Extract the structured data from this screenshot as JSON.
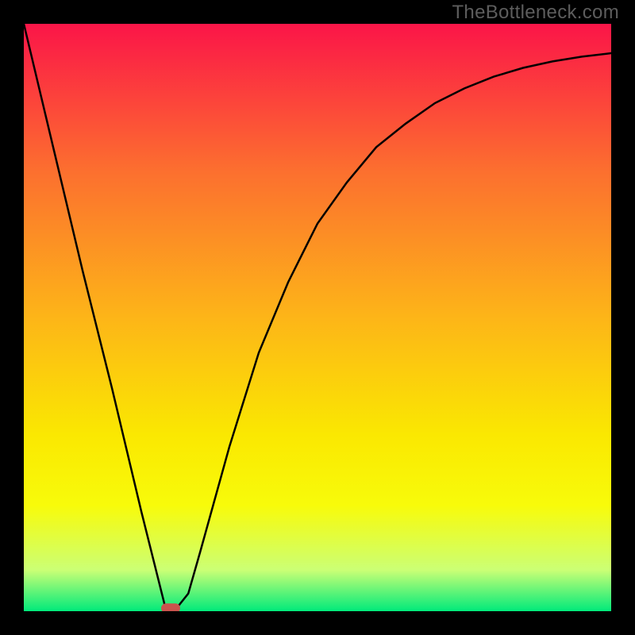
{
  "watermark": "TheBottleneck.com",
  "chart_data": {
    "type": "line",
    "title": "",
    "xlabel": "",
    "ylabel": "",
    "xlim": [
      0,
      100
    ],
    "ylim": [
      0,
      100
    ],
    "annotations": [],
    "background_gradient": {
      "c0": "#fb1548",
      "c25": "#fc6f2f",
      "c50": "#fdb518",
      "c70": "#fae801",
      "c80": "#f8fb0a",
      "c90": "#cbff75",
      "c100": "#00ea7b"
    },
    "series": [
      {
        "name": "bottleneck-curve",
        "x": [
          0,
          5,
          10,
          15,
          20,
          24,
          26,
          28,
          30,
          35,
          40,
          45,
          50,
          55,
          60,
          65,
          70,
          75,
          80,
          85,
          90,
          95,
          100
        ],
        "y": [
          100,
          79,
          58,
          38,
          17,
          1,
          0.5,
          3,
          10,
          28,
          44,
          56,
          66,
          73,
          79,
          83,
          86.5,
          89,
          91,
          92.5,
          93.6,
          94.4,
          95
        ]
      }
    ],
    "marker": {
      "name": "optimal-point",
      "x": 25,
      "y": 0.5,
      "color": "#c9534d"
    }
  }
}
